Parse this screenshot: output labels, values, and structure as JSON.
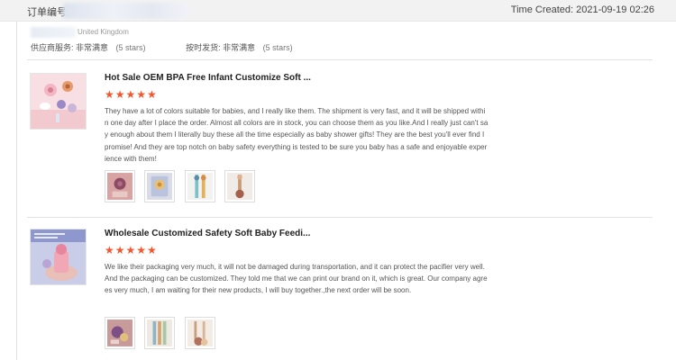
{
  "header": {
    "order_label": "订单编号",
    "time_created": "Time Created: 2021-09-19 02:26"
  },
  "customer": {
    "country": "United Kingdom"
  },
  "ratings": {
    "supplier_service_label": "供应商服务: 非常满意",
    "supplier_service_stars": "(5 stars)",
    "on_time_label": "按时发货: 非常满意",
    "on_time_stars": "(5 stars)"
  },
  "reviews": [
    {
      "title": "Hot Sale OEM BPA Free Infant Customize Soft ...",
      "stars": "★★★★★",
      "rating": 5,
      "text": "They have a lot of colors suitable for babies, and I really like them. The shipment is very fast, and it will be shipped within one day after I place the order. Almost all colors are in stock, you can choose them as you like.And I really just can't say enough about them I literally buy these all the time especially as baby shower gifts! They are the best you'll ever find I promise! And they are top notch on baby safety everything is tested to be sure you baby has a safe and enjoyable experience with them!",
      "photo_count": 4
    },
    {
      "title": "Wholesale Customized Safety Soft Baby Feedi...",
      "stars": "★★★★★",
      "rating": 5,
      "text": "We like their packaging very much, it will not be damaged during transportation, and it can protect the pacifier very well.And the packaging can be customized. They told me that we can print our brand on it, which is great. Our company agrees very much, I am waiting for their new products, I will buy together.,the next order will be soon.",
      "photo_count": 3
    }
  ],
  "colors": {
    "star": "#f4552c",
    "topbar_bg": "#f2f2f2"
  }
}
